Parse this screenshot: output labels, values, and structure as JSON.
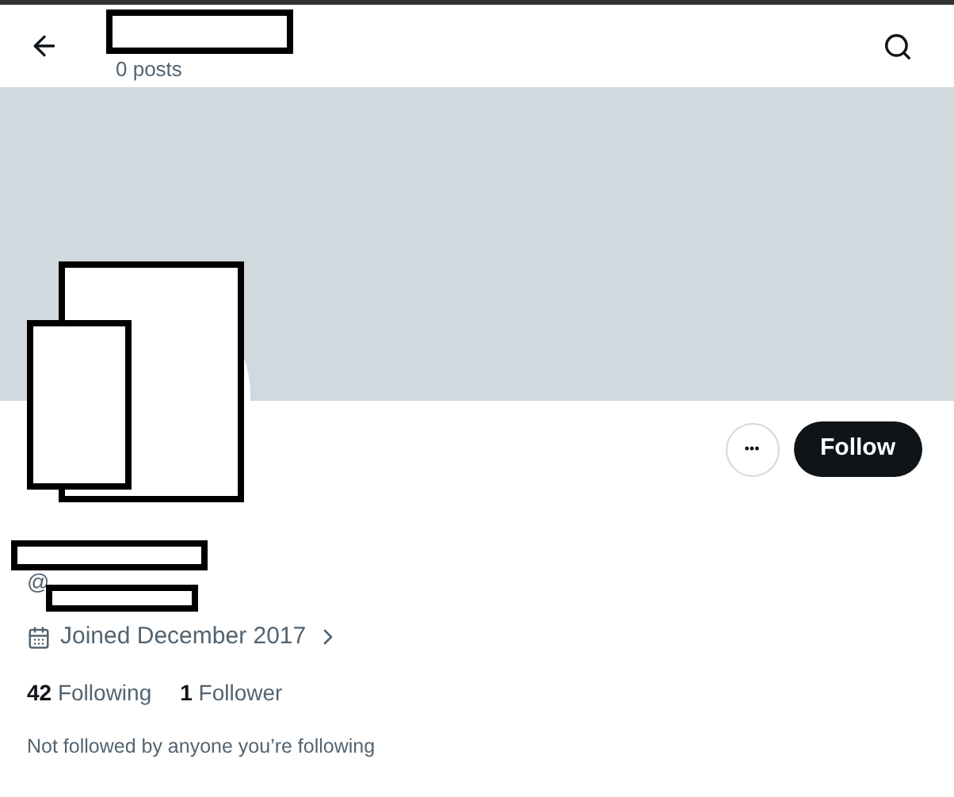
{
  "header": {
    "posts_count": "0 posts"
  },
  "profile": {
    "handle_prefix": "@",
    "joined": "Joined December 2017",
    "stats": [
      {
        "text": "**42** Following"
      },
      {
        "text": "**1** Follower"
      }
    ],
    "followed_by": "Not followed by anyone you’re following"
  },
  "actions": {
    "more": "•••",
    "follow": "Follow"
  }
}
